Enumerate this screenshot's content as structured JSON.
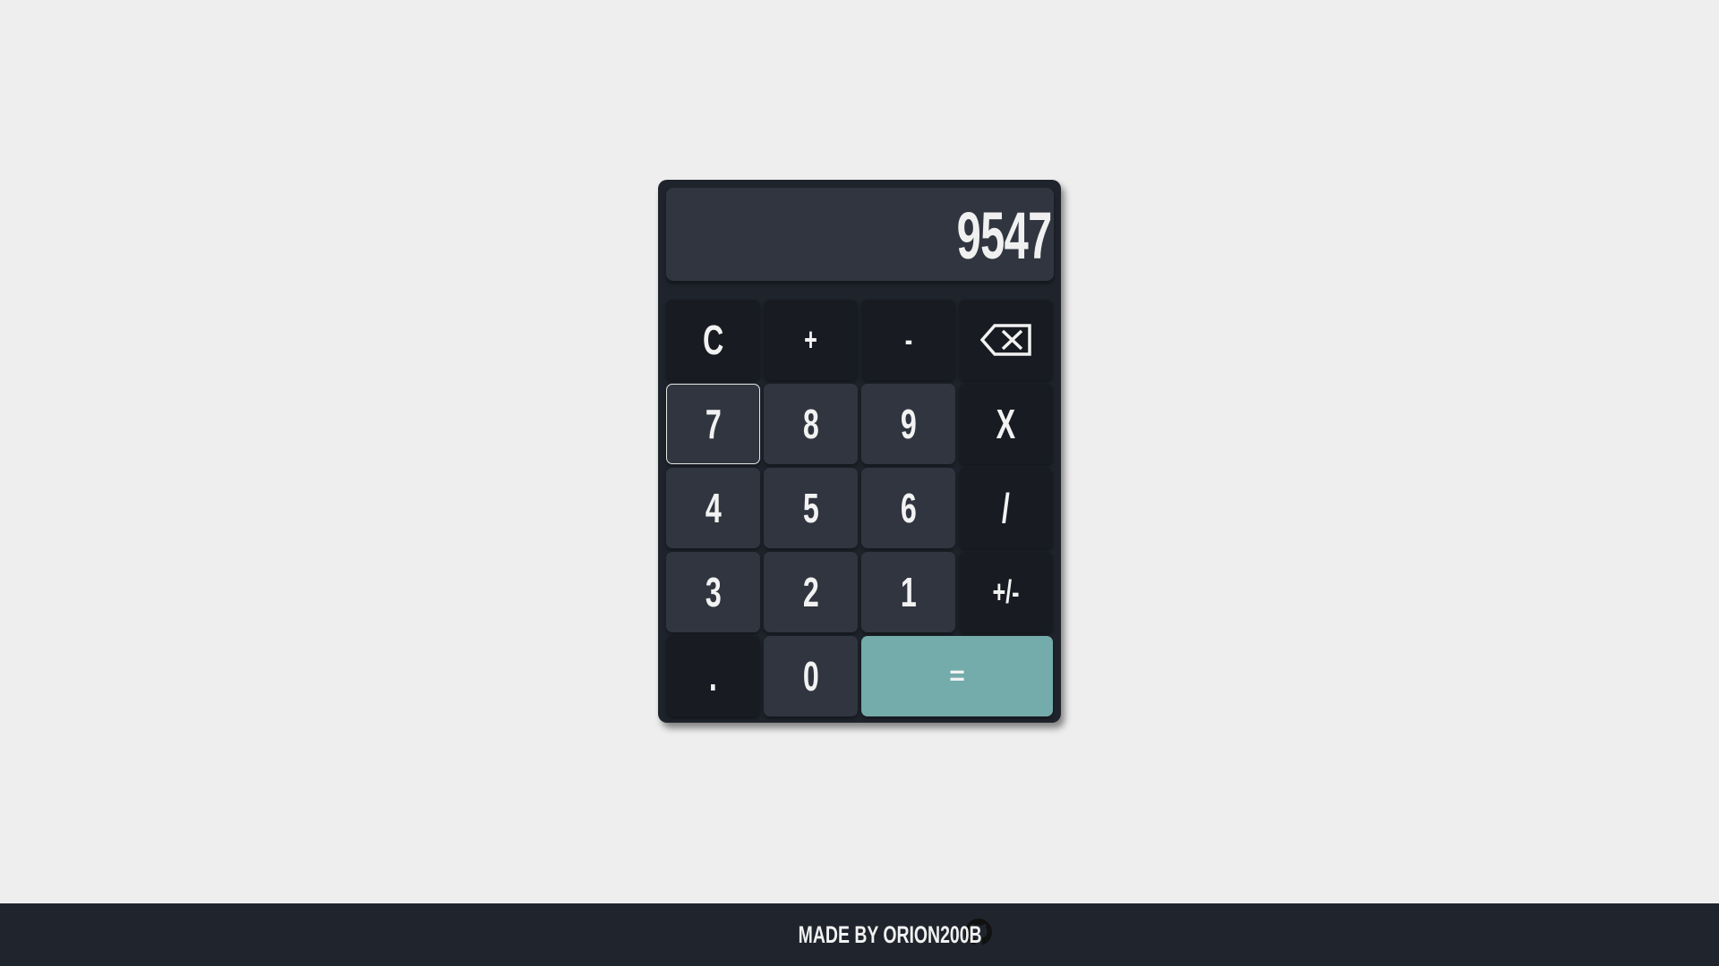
{
  "display": {
    "value": "9547"
  },
  "keys": {
    "clear": "C",
    "plus": "+",
    "minus": "-",
    "backspace_icon": "backspace-icon",
    "seven": "7",
    "eight": "8",
    "nine": "9",
    "multiply": "X",
    "four": "4",
    "five": "5",
    "six": "6",
    "divide": "/",
    "three": "3",
    "two": "2",
    "one": "1",
    "sign": "+/-",
    "decimal": ".",
    "zero": "0",
    "equals": "="
  },
  "footer": {
    "credit": "MADE BY ORION200B",
    "icon": "github-icon"
  },
  "colors": {
    "page_bg": "#eeeeee",
    "calculator_bg": "#1f242c",
    "display_bg": "#30353f",
    "key_dark": "#181b21",
    "key_gray": "#30353f",
    "equals_accent": "#74abab",
    "footer_bg": "#20252d"
  }
}
